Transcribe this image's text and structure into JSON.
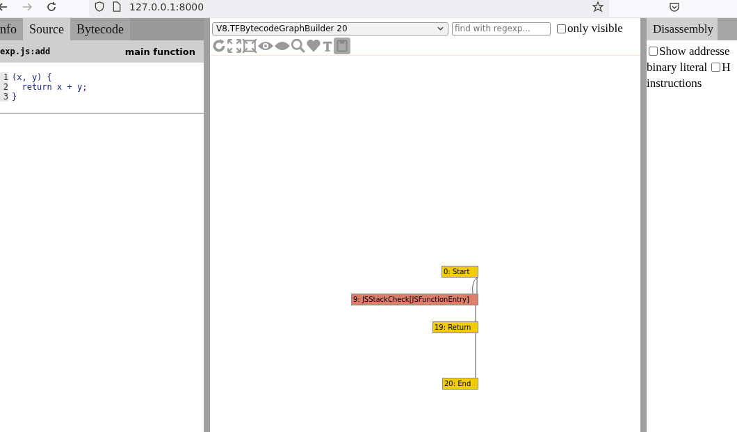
{
  "browser": {
    "url": "127.0.0.1:8000"
  },
  "left_panel": {
    "tabs": [
      {
        "label": "nfo",
        "selected": false
      },
      {
        "label": "Source",
        "selected": true
      },
      {
        "label": "Bytecode",
        "selected": false
      }
    ],
    "header": {
      "name": "exp.js:add",
      "role": "main function"
    },
    "code": [
      {
        "number": "1",
        "text": "(x, y) {"
      },
      {
        "number": "2",
        "text": "  return x + y;"
      },
      {
        "number": "3",
        "text": "}"
      }
    ]
  },
  "graph_panel": {
    "phase": "V8.TFBytecodeGraphBuilder 20",
    "search": {
      "placeholder": "find with regexp..."
    },
    "only_visible": {
      "label": "only visible",
      "checked": false
    },
    "nodes": [
      {
        "label": "0: Start",
        "color": "#f0cc00"
      },
      {
        "label": "9: JSStackCheck[JSFunctionEntry]",
        "color": "#dc7e6c"
      },
      {
        "label": "19: Return",
        "color": "#f0cc00"
      },
      {
        "label": "20: End",
        "color": "#f0cc00"
      }
    ]
  },
  "right_panel": {
    "tabs": [
      {
        "label": "Disassembly",
        "selected": true
      },
      {
        "selected": false
      }
    ],
    "options": [
      {
        "kind": "checkbox",
        "label": "Show addresse",
        "checked": false
      },
      {
        "kind": "text",
        "label": "binary literal"
      },
      {
        "kind": "checkbox",
        "label": "H",
        "checked": false
      },
      {
        "kind": "text",
        "label": "instructions"
      }
    ]
  }
}
